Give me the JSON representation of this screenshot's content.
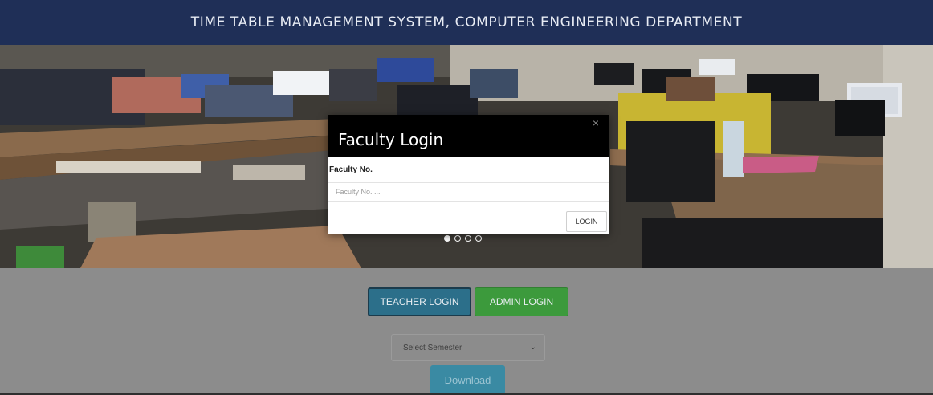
{
  "header": {
    "title": "TIME TABLE MANAGEMENT SYSTEM, COMPUTER ENGINEERING DEPARTMENT"
  },
  "carousel": {
    "slide_count": 4,
    "active_index": 0
  },
  "modal": {
    "title": "Faculty Login",
    "close_glyph": "×",
    "field_label": "Faculty No.",
    "field_placeholder": "Faculty No. ...",
    "field_value": "",
    "login_label": "LOGIN"
  },
  "actions": {
    "teacher_login_label": "TEACHER LOGIN",
    "admin_login_label": "ADMIN LOGIN",
    "semester_select_value": "Select Semester",
    "download_label": "Download"
  },
  "colors": {
    "header_bg": "#1f2f57",
    "teacher_btn": "#2c6f8a",
    "admin_btn": "#3c9a3c",
    "download_btn": "#3a8aa3",
    "page_bg": "#8c8c8c"
  }
}
